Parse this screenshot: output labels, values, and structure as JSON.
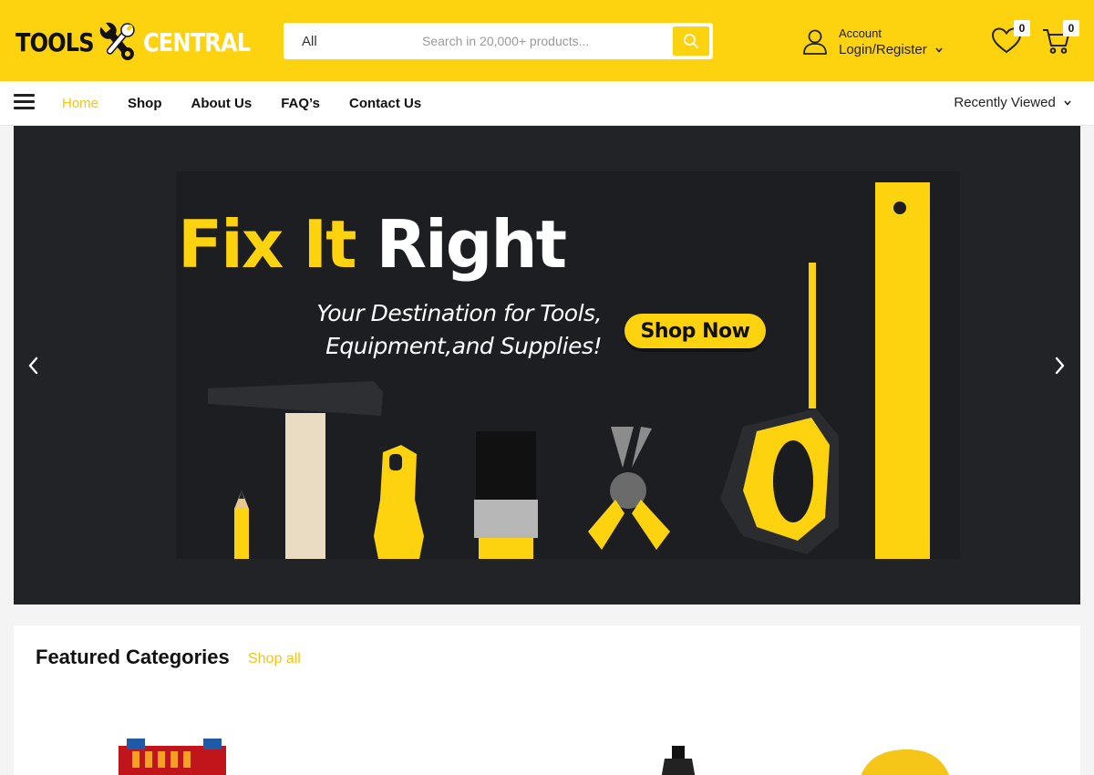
{
  "header": {
    "logo": {
      "word1": "TOOLS",
      "word2": "CENTRAL"
    },
    "search": {
      "category": "All",
      "placeholder": "Search in 20,000+ products..."
    },
    "account": {
      "label": "Account",
      "action": "Login/Register"
    },
    "wishlist_count": "0",
    "cart_count": "0"
  },
  "nav": {
    "links": [
      "Home",
      "Shop",
      "About Us",
      "FAQ’s",
      "Contact Us"
    ],
    "active": "Home",
    "recently_viewed": "Recently Viewed"
  },
  "banner": {
    "title_part1": "Fix It",
    "title_part2": "Right",
    "subtitle_line1": "Your Destination for Tools,",
    "subtitle_line2": "Equipment,and Supplies!",
    "cta": "Shop Now"
  },
  "featured": {
    "title": "Featured Categories",
    "link": "Shop all"
  },
  "colors": {
    "brand_yellow": "#fdd20e",
    "dark": "#222327",
    "text": "#111111"
  },
  "icons": [
    "wrench-icon",
    "search-icon",
    "user-icon",
    "heart-icon",
    "cart-icon",
    "menu-icon",
    "chevron-down-icon",
    "chevron-left-icon",
    "chevron-right-icon"
  ]
}
